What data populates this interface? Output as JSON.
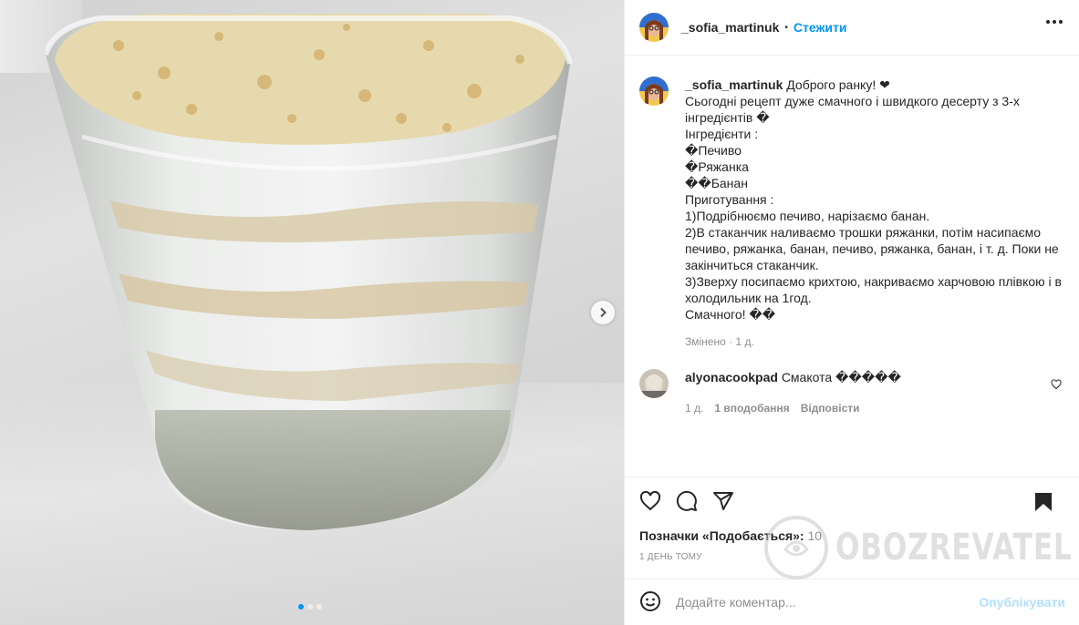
{
  "post": {
    "image_alt": "",
    "carousel": {
      "count": 3,
      "active": 1
    }
  },
  "header": {
    "username": "_sofia_martinuk",
    "separator": "•",
    "follow_label": "Стежити"
  },
  "caption": {
    "username": "_sofia_martinuk",
    "lines": [
      "Доброго ранку! ❤",
      "Сьогодні рецепт дуже смачного і швидкого десерту з 3-х інгредієнтів �",
      "Інгредієнти :",
      "�Печиво",
      "�Ряжанка",
      "��Банан",
      "Приготування :",
      "1)Подрібнюємо печиво, нарізаємо банан.",
      "2)В стаканчик наливаємо трошки ряжанки, потім насипаємо печиво, ряжанка, банан, печиво, ряжанка, банан, і т. д. Поки не закінчиться стаканчик.",
      "3)Зверху посипаємо крихтою, накриваємо харчовою плівкою і в холодильник на 1год.",
      "Смачного! ��"
    ],
    "meta": "Змінено · 1 д."
  },
  "comments": [
    {
      "username": "alyonacookpad",
      "text": "Смакота �����",
      "time": "1 д.",
      "likes": "1 вподобання",
      "reply": "Відповісти"
    }
  ],
  "footer": {
    "likes_label": "Позначки «Подобається»:",
    "likes_count": "10",
    "date": "1 ДЕНЬ ТОМУ",
    "comment_placeholder": "Додайте коментар...",
    "post_label": "Опублікувати"
  },
  "watermark": {
    "text": "OBOZREVATEL"
  },
  "colors": {
    "accent": "#0095f6",
    "post_disabled": "#b2dffc",
    "muted": "#8e8e8e",
    "text": "#262626"
  },
  "icons": [
    "more-icon",
    "heart-icon",
    "comment-icon",
    "share-icon",
    "bookmark-icon",
    "emoji-icon",
    "chevron-right-icon"
  ]
}
